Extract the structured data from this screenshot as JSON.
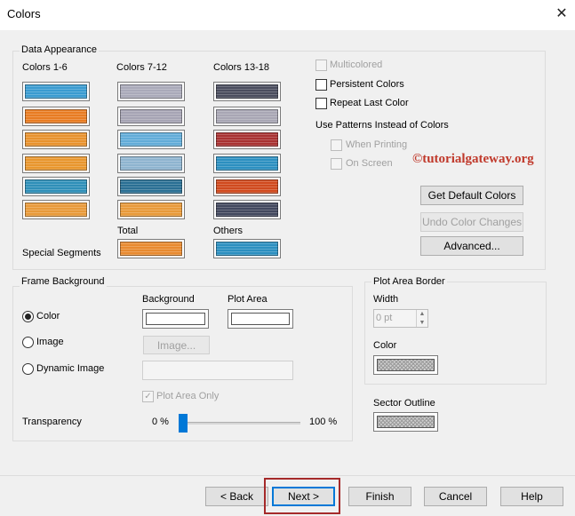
{
  "window": {
    "title": "Colors"
  },
  "data_appearance": {
    "title": "Data Appearance",
    "col_headers": [
      "Colors 1-6",
      "Colors 7-12",
      "Colors 13-18"
    ],
    "swatches": [
      [
        "#3a9bd0",
        "#e87c22",
        "#e8922e",
        "#e8962e",
        "#2f8fb8",
        "#e89a3a"
      ],
      [
        "#a9a9b9",
        "#a6a4b4",
        "#62acd8",
        "#8eb4cf",
        "#2a6f94",
        "#e89a3a"
      ],
      [
        "#4a4d5e",
        "#a8a6b4",
        "#a83232",
        "#2c8fc0",
        "#d04a1e",
        "#42485e"
      ]
    ],
    "total_label": "Total",
    "others_label": "Others",
    "special_segments_label": "Special Segments",
    "total_color": "#e88a30",
    "others_color": "#2c8fc0",
    "multicolored_label": "Multicolored",
    "persistent_colors_label": "Persistent Colors",
    "repeat_last_color_label": "Repeat Last Color",
    "use_patterns_label": "Use Patterns Instead of Colors",
    "when_printing_label": "When Printing",
    "on_screen_label": "On Screen",
    "watermark": "©tutorialgateway.org",
    "get_default_colors": "Get Default Colors",
    "undo_color_changes": "Undo Color Changes",
    "advanced": "Advanced..."
  },
  "frame_background": {
    "title": "Frame Background",
    "background_label": "Background",
    "plot_area_label": "Plot Area",
    "color_label": "Color",
    "image_label": "Image",
    "dynamic_image_label": "Dynamic Image",
    "image_button": "Image...",
    "plot_area_only_label": "Plot Area Only",
    "transparency_label": "Transparency",
    "transparency_min": "0 %",
    "transparency_max": "100 %",
    "transparency_value": 0,
    "selected": "Color"
  },
  "plot_area_border": {
    "title": "Plot Area Border",
    "width_label": "Width",
    "width_value": "0 pt",
    "color_label": "Color",
    "sector_outline_label": "Sector Outline"
  },
  "footer": {
    "back": "< Back",
    "next": "Next >",
    "finish": "Finish",
    "cancel": "Cancel",
    "help": "Help"
  }
}
